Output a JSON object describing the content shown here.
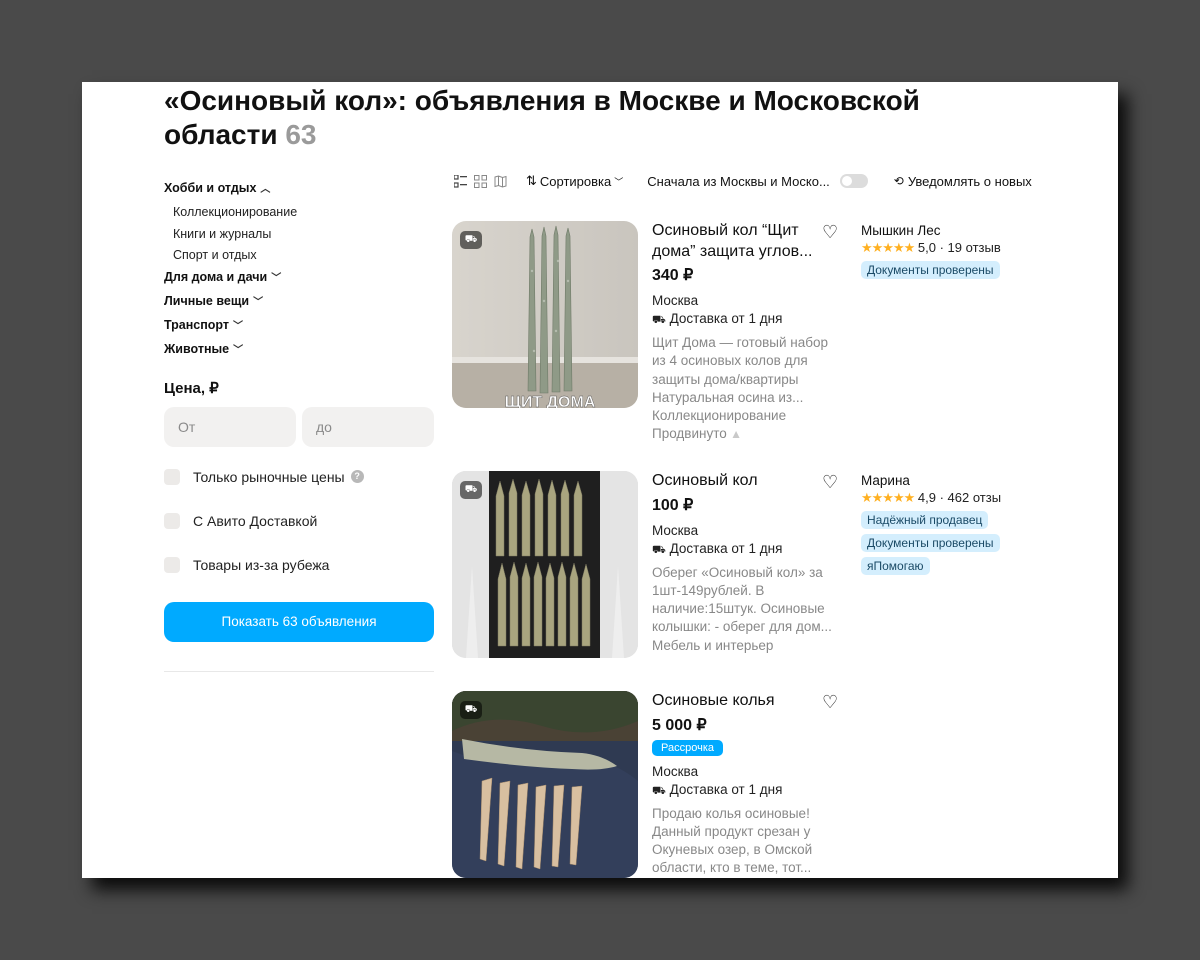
{
  "header": {
    "title": "«Осиновый кол»: объявления в Москве и Московской области",
    "count": "63"
  },
  "sidebar": {
    "categories": [
      {
        "label": "Хобби и отдых",
        "chevron": "⌃",
        "sub": [
          "Коллекционирование",
          "Книги и журналы",
          "Спорт и отдых"
        ]
      },
      {
        "label": "Для дома и дачи",
        "chevron": "⌄"
      },
      {
        "label": "Личные вещи",
        "chevron": "⌄"
      },
      {
        "label": "Транспорт",
        "chevron": "⌄"
      },
      {
        "label": "Животные",
        "chevron": "⌄"
      }
    ],
    "price": {
      "heading": "Цена, ₽",
      "from_placeholder": "От",
      "to_placeholder": "до"
    },
    "checkboxes": [
      "Только рыночные цены",
      "С Авито Доставкой",
      "Товары из-за рубежа"
    ],
    "question_icon": "?",
    "show_button": "Показать 63 объявления"
  },
  "toolbar": {
    "sort": "Сортировка",
    "region": "Сначала из Москвы и Моско...",
    "notify": "Уведомлять о новых"
  },
  "listings": [
    {
      "title": "Осиновый кол “Щит дома” защита углов...",
      "price": "340 ₽",
      "location": "Москва",
      "delivery": "Доставка от 1 дня",
      "description": "Щит Дома — готовый набор из 4 осиновых колов для защиты дома/квартиры Натуральная осина из...",
      "category": "Коллекционирование",
      "promo": "Продвинуто",
      "photo_caption": "ЩИТ ДОМА",
      "seller": {
        "name": "Мышкин Лес",
        "rating": "5,0",
        "reviews": "19 отзыв",
        "stars": "★★★★★",
        "tags": [
          "Документы проверены"
        ]
      }
    },
    {
      "title": "Осиновый кол",
      "price": "100 ₽",
      "location": "Москва",
      "delivery": "Доставка от 1 дня",
      "description": "Оберег «Осиновый кол» за 1шт-149рублей. В наличие:15штук. Осиновые колышки: - оберег для дом...",
      "category": "Мебель и интерьер",
      "seller": {
        "name": "Марина",
        "rating": "4,9",
        "reviews": "462 отзы",
        "stars": "★★★★★",
        "tags": [
          "Надёжный продавец",
          "Документы проверены",
          "яПомогаю"
        ]
      }
    },
    {
      "title": "Осиновые колья",
      "price": "5 000 ₽",
      "installment": "Рассрочка",
      "location": "Москва",
      "delivery": "Доставка от 1 дня",
      "description": "Продаю колья осиновые! Данный продукт срезан у Окуневых озер, в Омской области, кто в теме, тот..."
    }
  ],
  "icons": {
    "heart": "♡",
    "delivery": "⛟",
    "up_arrow": "🡅",
    "bell": "🔔"
  }
}
